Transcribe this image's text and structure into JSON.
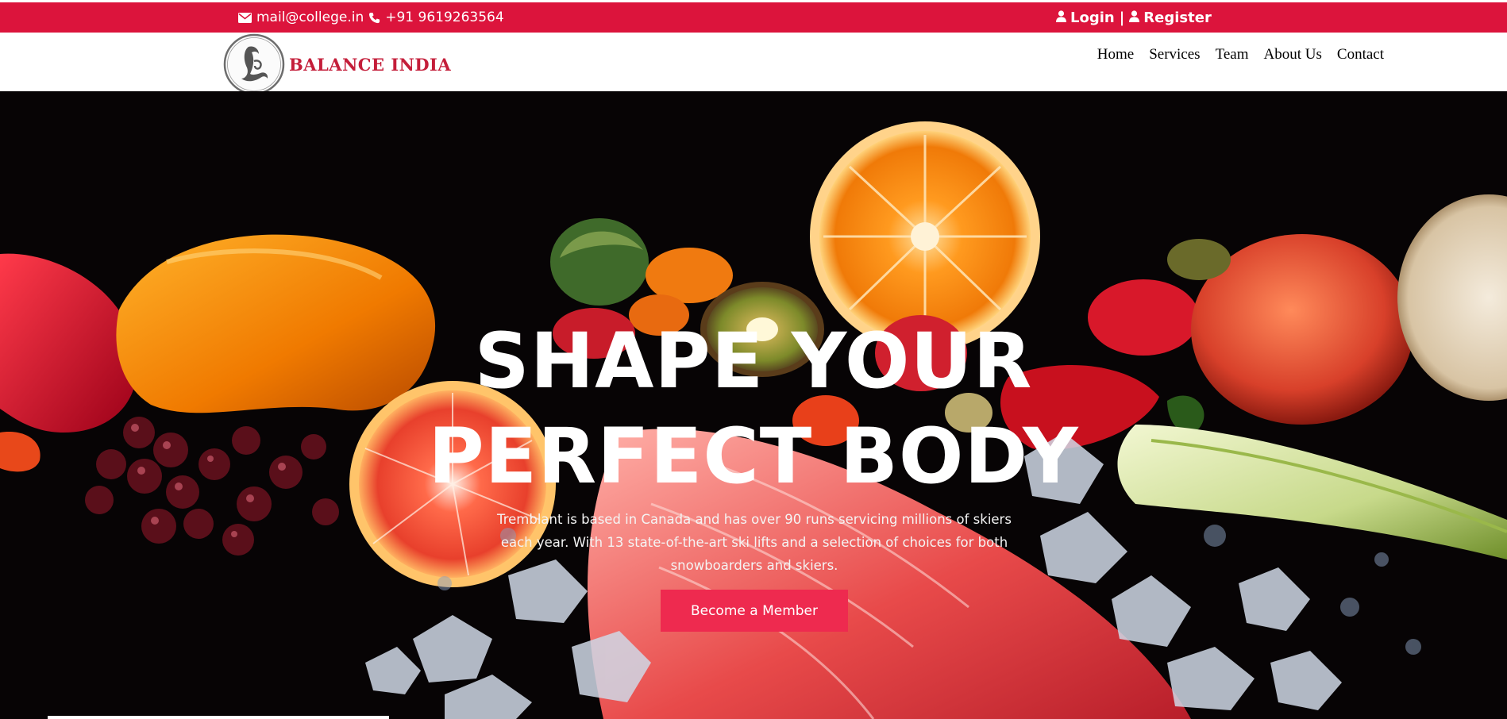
{
  "topbar": {
    "email": "mail@college.in",
    "phone": "+91 9619263564",
    "login_label": "Login",
    "separator": "|",
    "register_label": "Register"
  },
  "brand": {
    "name": "BALANCE INDIA"
  },
  "nav": {
    "items": [
      "Home",
      "Services",
      "Team",
      "About Us",
      "Contact"
    ]
  },
  "hero": {
    "title_line1": "SHAPE YOUR",
    "title_line2": "PERFECT BODY",
    "text": "Tremblant is based in Canada and has over 90 runs servicing millions of skiers each year. With 13 state-of-the-art ski lifts and a selection of choices for both snowboarders and skiers.",
    "button_label": "Become a Member"
  },
  "colors": {
    "brand_red": "#dc143c",
    "button_red": "#ee2a4f",
    "hero_bg": "#080506"
  }
}
